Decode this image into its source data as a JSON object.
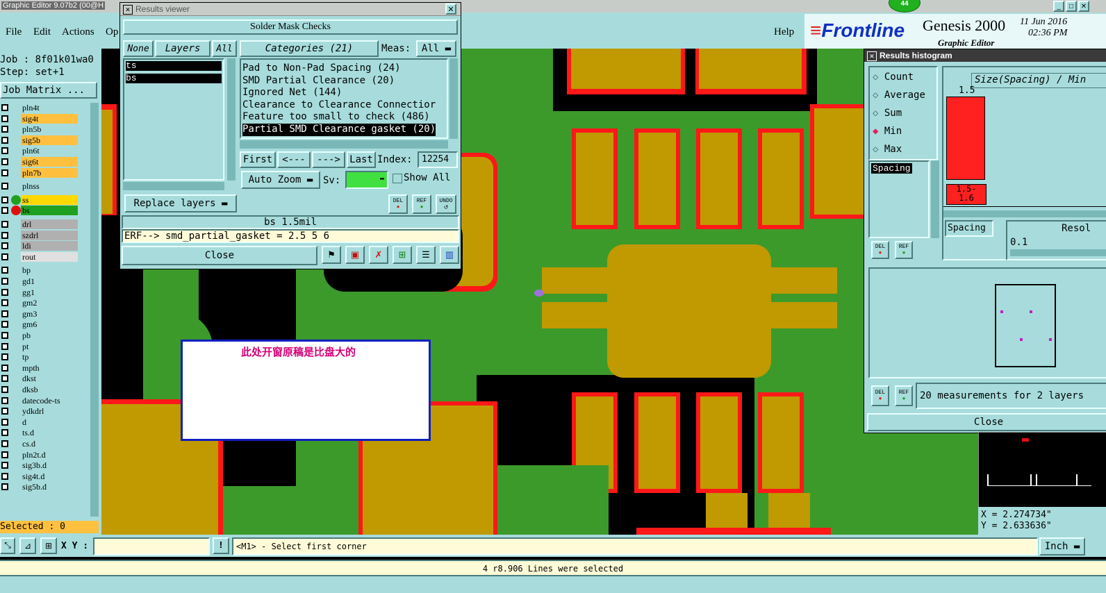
{
  "app": {
    "title": "Graphic Editor 9.07b2 (00@H",
    "menu": [
      "File",
      "Edit",
      "Actions",
      "Op"
    ],
    "help": "Help",
    "brand": "Frontline",
    "product": "Genesis 2000",
    "product_sub": "Graphic Editor",
    "date": "11 Jun 2016",
    "time": "02:36 PM",
    "badge": "44"
  },
  "left_panel": {
    "job": "Job : 8f01k01wa0",
    "step": "Step: set+1",
    "job_matrix": "Job Matrix ...",
    "selected": "Selected : 0",
    "layers": [
      {
        "name": "pln4t",
        "color": "#a8dcdc"
      },
      {
        "name": "sig4t",
        "color": "#ffc040"
      },
      {
        "name": "pln5b",
        "color": "#a8dcdc"
      },
      {
        "name": "sig5b",
        "color": "#ffc040"
      },
      {
        "name": "pln6t",
        "color": "#a8dcdc"
      },
      {
        "name": "sig6t",
        "color": "#ffc040"
      },
      {
        "name": "pln7b",
        "color": "#ffc040"
      },
      {
        "name": "plnss",
        "color": "#a8dcdc"
      },
      {
        "name": "ss",
        "color": "#ffd800"
      },
      {
        "name": "bs",
        "color": "#20a020"
      },
      {
        "name": "drl",
        "color": "#b0b0b0"
      },
      {
        "name": "szdrl",
        "color": "#b0b0b0"
      },
      {
        "name": "ldi",
        "color": "#b0b0b0"
      },
      {
        "name": "rout",
        "color": "#e0e0e0"
      },
      {
        "name": "bp",
        "color": "#a8dcdc"
      },
      {
        "name": "gd1",
        "color": "#a8dcdc"
      },
      {
        "name": "gg1",
        "color": "#a8dcdc"
      },
      {
        "name": "gm2",
        "color": "#a8dcdc"
      },
      {
        "name": "gm3",
        "color": "#a8dcdc"
      },
      {
        "name": "gm6",
        "color": "#a8dcdc"
      },
      {
        "name": "pb",
        "color": "#a8dcdc"
      },
      {
        "name": "pt",
        "color": "#a8dcdc"
      },
      {
        "name": "tp",
        "color": "#a8dcdc"
      },
      {
        "name": "mpth",
        "color": "#a8dcdc"
      },
      {
        "name": "dkst",
        "color": "#a8dcdc"
      },
      {
        "name": "dksb",
        "color": "#a8dcdc"
      },
      {
        "name": "datecode-ts",
        "color": "#a8dcdc"
      },
      {
        "name": "ydkdrl",
        "color": "#a8dcdc"
      },
      {
        "name": "d",
        "color": "#a8dcdc"
      },
      {
        "name": "ts.d",
        "color": "#a8dcdc"
      },
      {
        "name": "cs.d",
        "color": "#a8dcdc"
      },
      {
        "name": "pln2t.d",
        "color": "#a8dcdc"
      },
      {
        "name": "sig3b.d",
        "color": "#a8dcdc"
      },
      {
        "name": "sig4t.d",
        "color": "#a8dcdc"
      },
      {
        "name": "sig5b.d",
        "color": "#a8dcdc"
      }
    ]
  },
  "results_viewer": {
    "title": "Results viewer",
    "header": "Solder Mask Checks",
    "none_btn": "None",
    "layers_btn": "Layers",
    "all_btn": "All",
    "layers_list": [
      "ts",
      "bs"
    ],
    "categories_label": "Categories (21)",
    "meas_label": "Meas:",
    "meas_value": "All",
    "categories": [
      "Pad to Non-Pad Spacing (24)",
      "SMD Partial Clearance (20)",
      "Ignored Net (144)",
      "Clearance to Clearance Connectior",
      "Feature too small to check (486)",
      "Partial SMD Clearance gasket (20)"
    ],
    "first": "First",
    "prev": "<---",
    "next": "--->",
    "last": "Last",
    "index_label": "Index:",
    "index_value": "12254",
    "auto_zoom": "Auto Zoom",
    "sv_label": "Sv:",
    "show_all": "Show All",
    "replace_layers": "Replace layers",
    "del": "DEL",
    "ref": "REF",
    "undo": "UNDO",
    "status1": "bs 1.5mil",
    "status2": "ERF--> smd_partial_gasket = 2.5 5 6",
    "close": "Close"
  },
  "histogram": {
    "title": "Results histogram",
    "options": [
      "Count",
      "Average",
      "Sum",
      "Min",
      "Max"
    ],
    "selected_option": "Min",
    "header": "Size(Spacing) / Min",
    "bar_value": "1.5",
    "bar_fraction": 1.0,
    "bin_label": "1.5-\n1.6",
    "list_item": "Spacing",
    "spacing_sel": "Spacing",
    "resol_label": "Resol",
    "resol_value": "0.1",
    "measurements": "20 measurements for 2 layers",
    "close": "Close"
  },
  "note": {
    "text": "此处开窗原稿是比盘大的",
    "color": "#d4007a"
  },
  "coords": {
    "x": "X = 2.274734\"",
    "y": "Y = 2.633636\""
  },
  "bottom": {
    "xy_label": "X Y :",
    "prompt": "<M1> - Select first corner",
    "units": "Inch",
    "status": "4 r8.906 Lines were selected"
  },
  "colors": {
    "copper": "#c09a00",
    "mask": "#3c9a2a",
    "clearance": "#ff1818",
    "panel": "#a8dcdc"
  }
}
